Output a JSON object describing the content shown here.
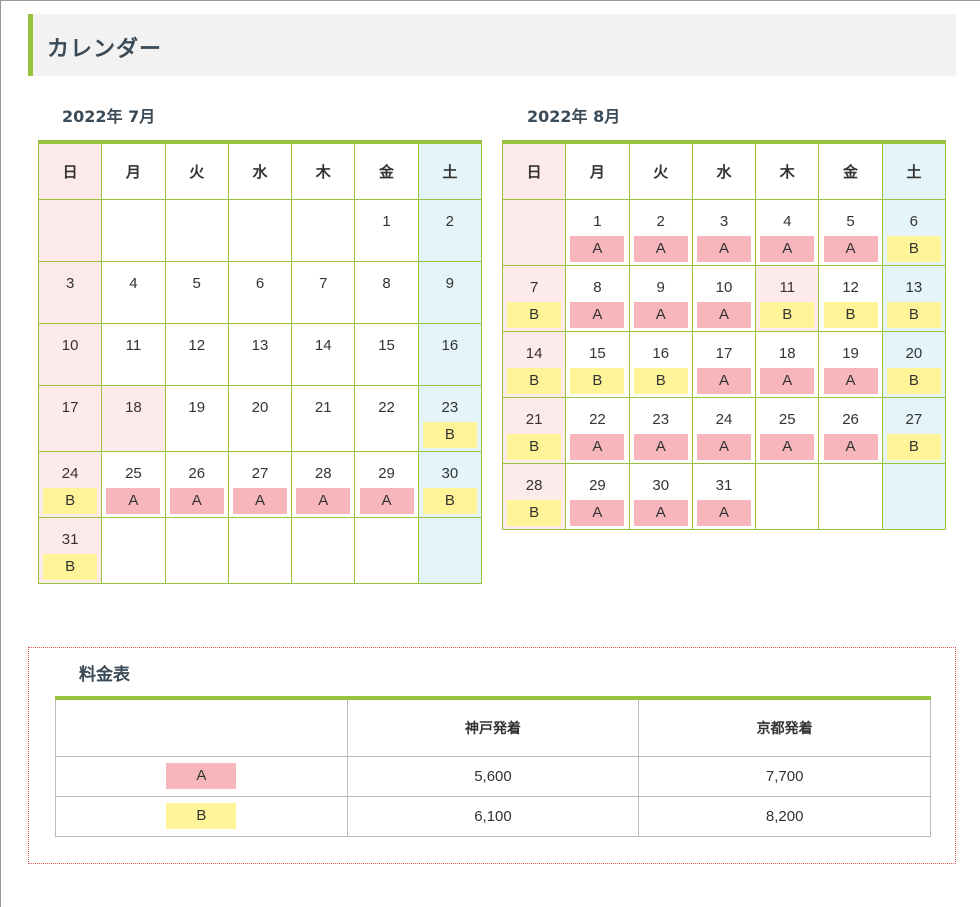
{
  "heading": "カレンダー",
  "weekdays": [
    "日",
    "月",
    "火",
    "水",
    "木",
    "金",
    "土"
  ],
  "colors": {
    "accent": "#99c33c",
    "A": "#f6b6bb",
    "B": "#fff598",
    "sunday": "#fdeaea",
    "saturday": "#e5f4f9",
    "holiday": "#fdeaea"
  },
  "july": {
    "title": "2022年 7月",
    "weeks": [
      [
        {
          "d": ""
        },
        {
          "d": ""
        },
        {
          "d": ""
        },
        {
          "d": ""
        },
        {
          "d": ""
        },
        {
          "d": "1"
        },
        {
          "d": "2"
        }
      ],
      [
        {
          "d": "3"
        },
        {
          "d": "4"
        },
        {
          "d": "5"
        },
        {
          "d": "6"
        },
        {
          "d": "7"
        },
        {
          "d": "8"
        },
        {
          "d": "9"
        }
      ],
      [
        {
          "d": "10"
        },
        {
          "d": "11"
        },
        {
          "d": "12"
        },
        {
          "d": "13"
        },
        {
          "d": "14"
        },
        {
          "d": "15"
        },
        {
          "d": "16"
        }
      ],
      [
        {
          "d": "17"
        },
        {
          "d": "18",
          "holiday": true
        },
        {
          "d": "19"
        },
        {
          "d": "20"
        },
        {
          "d": "21"
        },
        {
          "d": "22"
        },
        {
          "d": "23",
          "r": "B"
        }
      ],
      [
        {
          "d": "24",
          "r": "B"
        },
        {
          "d": "25",
          "r": "A"
        },
        {
          "d": "26",
          "r": "A"
        },
        {
          "d": "27",
          "r": "A"
        },
        {
          "d": "28",
          "r": "A"
        },
        {
          "d": "29",
          "r": "A"
        },
        {
          "d": "30",
          "r": "B"
        }
      ],
      [
        {
          "d": "31",
          "r": "B"
        },
        {
          "d": ""
        },
        {
          "d": ""
        },
        {
          "d": ""
        },
        {
          "d": ""
        },
        {
          "d": ""
        },
        {
          "d": ""
        }
      ]
    ]
  },
  "august": {
    "title": "2022年 8月",
    "weeks": [
      [
        {
          "d": ""
        },
        {
          "d": "1",
          "r": "A"
        },
        {
          "d": "2",
          "r": "A"
        },
        {
          "d": "3",
          "r": "A"
        },
        {
          "d": "4",
          "r": "A"
        },
        {
          "d": "5",
          "r": "A"
        },
        {
          "d": "6",
          "r": "B"
        }
      ],
      [
        {
          "d": "7",
          "r": "B"
        },
        {
          "d": "8",
          "r": "A"
        },
        {
          "d": "9",
          "r": "A"
        },
        {
          "d": "10",
          "r": "A"
        },
        {
          "d": "11",
          "r": "B",
          "holiday": true
        },
        {
          "d": "12",
          "r": "B"
        },
        {
          "d": "13",
          "r": "B"
        }
      ],
      [
        {
          "d": "14",
          "r": "B"
        },
        {
          "d": "15",
          "r": "B"
        },
        {
          "d": "16",
          "r": "B"
        },
        {
          "d": "17",
          "r": "A"
        },
        {
          "d": "18",
          "r": "A"
        },
        {
          "d": "19",
          "r": "A"
        },
        {
          "d": "20",
          "r": "B"
        }
      ],
      [
        {
          "d": "21",
          "r": "B"
        },
        {
          "d": "22",
          "r": "A"
        },
        {
          "d": "23",
          "r": "A"
        },
        {
          "d": "24",
          "r": "A"
        },
        {
          "d": "25",
          "r": "A"
        },
        {
          "d": "26",
          "r": "A"
        },
        {
          "d": "27",
          "r": "B"
        }
      ],
      [
        {
          "d": "28",
          "r": "B"
        },
        {
          "d": "29",
          "r": "A"
        },
        {
          "d": "30",
          "r": "A"
        },
        {
          "d": "31",
          "r": "A"
        },
        {
          "d": ""
        },
        {
          "d": ""
        },
        {
          "d": ""
        }
      ]
    ]
  },
  "price": {
    "title": "料金表",
    "headers": [
      "",
      "神戸発着",
      "京都発着"
    ],
    "rows": [
      {
        "label": "A",
        "kobe": "5,600",
        "kyoto": "7,700"
      },
      {
        "label": "B",
        "kobe": "6,100",
        "kyoto": "8,200"
      }
    ]
  }
}
